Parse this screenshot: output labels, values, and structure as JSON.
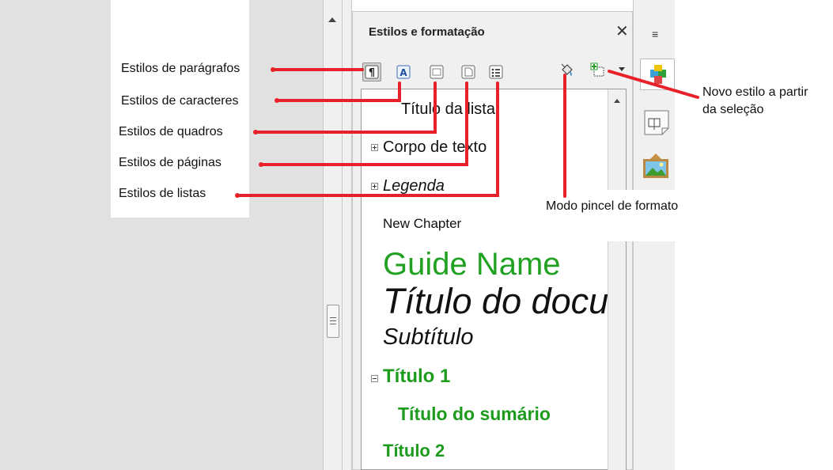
{
  "panel": {
    "title": "Estilos e formatação",
    "close_glyph": "✕",
    "menu_glyph": "≡"
  },
  "toolbar": {
    "buttons": [
      {
        "name": "paragraph-styles",
        "icon": "pilcrow-icon",
        "active": true
      },
      {
        "name": "character-styles",
        "icon": "character-a-icon",
        "active": false
      },
      {
        "name": "frame-styles",
        "icon": "frame-icon",
        "active": false
      },
      {
        "name": "page-styles",
        "icon": "page-icon",
        "active": false
      },
      {
        "name": "list-styles",
        "icon": "list-icon",
        "active": false
      },
      {
        "name": "fill-format-mode",
        "icon": "paint-bucket-icon",
        "active": false
      },
      {
        "name": "new-style-from-selection",
        "icon": "new-style-icon",
        "active": false
      }
    ]
  },
  "styles_list": [
    {
      "label": "Título da lista",
      "style": "plain-large"
    },
    {
      "label": "Corpo de texto",
      "style": "plain-large",
      "expander": "plus"
    },
    {
      "label": "Legenda",
      "style": "italic",
      "expander": "plus"
    },
    {
      "label": "New Chapter",
      "style": "small"
    },
    {
      "label": "Guide Name",
      "style": "green-huge"
    },
    {
      "label": "Título do documento",
      "style": "italic-huge"
    },
    {
      "label": "Subtítulo",
      "style": "italic-large"
    },
    {
      "label": "Título 1",
      "style": "green-bold",
      "expander": "minus"
    },
    {
      "label": "Título do sumário",
      "style": "green-bold-indent"
    },
    {
      "label": "Título 2",
      "style": "green-bold-small"
    }
  ],
  "annotations": {
    "paragraph_styles": "Estilos de parágrafos",
    "character_styles": "Estilos de caracteres",
    "frame_styles": "Estilos de quadros",
    "page_styles": "Estilos de páginas",
    "list_styles": "Estilos de listas",
    "fill_format": "Modo pincel de formato",
    "new_style_line1": "Novo estilo a partir",
    "new_style_line2": "da seleção"
  },
  "colors": {
    "callout_line": "#e8202a",
    "heading_green": "#21a121",
    "accent_green": "#1c9b1c"
  }
}
